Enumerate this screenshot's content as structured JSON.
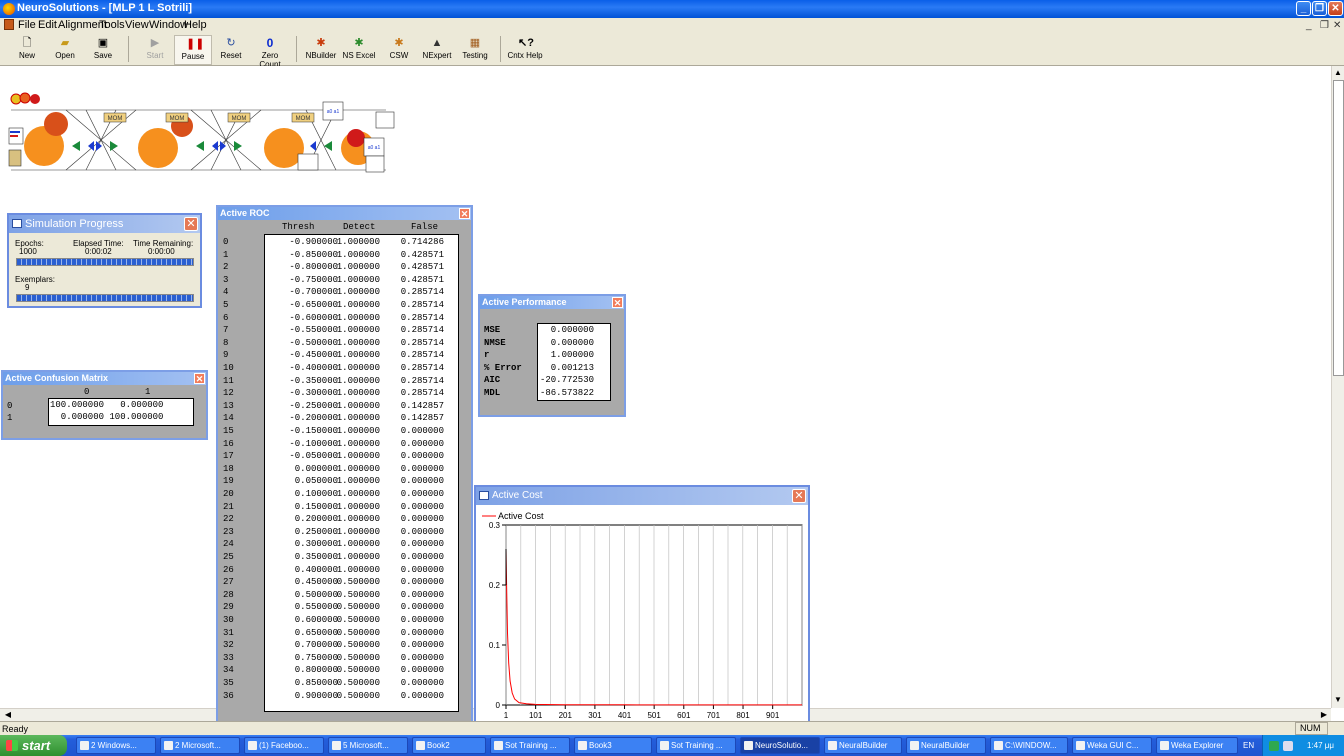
{
  "window": {
    "title": "NeuroSolutions - [MLP 1 L Sotrili]"
  },
  "menu": [
    "File",
    "Edit",
    "Alignment",
    "Tools",
    "View",
    "Window",
    "Help"
  ],
  "toolbar": {
    "new": "New",
    "open": "Open",
    "save": "Save",
    "start": "Start",
    "pause": "Pause",
    "reset": "Reset",
    "zero_count": "Zero Count",
    "zero_value": "0",
    "nbuilder": "NBuilder",
    "nsexcel": "NS Excel",
    "csw": "CSW",
    "nexpert": "NExpert",
    "testing": "Testing",
    "cntx_help": "Cntx Help"
  },
  "breadboard": {
    "mom_label": "MOM",
    "matrix_label": "a0 a1"
  },
  "sim_progress": {
    "title": "Simulation Progress",
    "epochs_label": "Epochs:",
    "epochs_value": "1000",
    "elapsed_label": "Elapsed Time:",
    "elapsed_value": "0:00:02",
    "remaining_label": "Time Remaining:",
    "remaining_value": "0:00:00",
    "exemplars_label": "Exemplars:",
    "exemplars_value": "9",
    "epoch_progress": 1.0,
    "exemplar_progress": 1.0
  },
  "confusion": {
    "title": "Active Confusion Matrix",
    "col_headers": [
      "0",
      "1"
    ],
    "rows": [
      {
        "label": "0",
        "values": "100.000000   0.000000"
      },
      {
        "label": "1",
        "values": "  0.000000 100.000000"
      }
    ]
  },
  "roc": {
    "title": "Active ROC",
    "headers": [
      "Thresh",
      "Detect",
      "False"
    ],
    "rows": [
      [
        "0",
        "-0.900000",
        "1.000000",
        "0.714286"
      ],
      [
        "1",
        "-0.850000",
        "1.000000",
        "0.428571"
      ],
      [
        "2",
        "-0.800000",
        "1.000000",
        "0.428571"
      ],
      [
        "3",
        "-0.750000",
        "1.000000",
        "0.428571"
      ],
      [
        "4",
        "-0.700000",
        "1.000000",
        "0.285714"
      ],
      [
        "5",
        "-0.650000",
        "1.000000",
        "0.285714"
      ],
      [
        "6",
        "-0.600000",
        "1.000000",
        "0.285714"
      ],
      [
        "7",
        "-0.550000",
        "1.000000",
        "0.285714"
      ],
      [
        "8",
        "-0.500000",
        "1.000000",
        "0.285714"
      ],
      [
        "9",
        "-0.450000",
        "1.000000",
        "0.285714"
      ],
      [
        "10",
        "-0.400000",
        "1.000000",
        "0.285714"
      ],
      [
        "11",
        "-0.350000",
        "1.000000",
        "0.285714"
      ],
      [
        "12",
        "-0.300000",
        "1.000000",
        "0.285714"
      ],
      [
        "13",
        "-0.250000",
        "1.000000",
        "0.142857"
      ],
      [
        "14",
        "-0.200000",
        "1.000000",
        "0.142857"
      ],
      [
        "15",
        "-0.150000",
        "1.000000",
        "0.000000"
      ],
      [
        "16",
        "-0.100000",
        "1.000000",
        "0.000000"
      ],
      [
        "17",
        "-0.050000",
        "1.000000",
        "0.000000"
      ],
      [
        "18",
        "0.000000",
        "1.000000",
        "0.000000"
      ],
      [
        "19",
        "0.050000",
        "1.000000",
        "0.000000"
      ],
      [
        "20",
        "0.100000",
        "1.000000",
        "0.000000"
      ],
      [
        "21",
        "0.150000",
        "1.000000",
        "0.000000"
      ],
      [
        "22",
        "0.200000",
        "1.000000",
        "0.000000"
      ],
      [
        "23",
        "0.250000",
        "1.000000",
        "0.000000"
      ],
      [
        "24",
        "0.300000",
        "1.000000",
        "0.000000"
      ],
      [
        "25",
        "0.350000",
        "1.000000",
        "0.000000"
      ],
      [
        "26",
        "0.400000",
        "1.000000",
        "0.000000"
      ],
      [
        "27",
        "0.450000",
        "0.500000",
        "0.000000"
      ],
      [
        "28",
        "0.500000",
        "0.500000",
        "0.000000"
      ],
      [
        "29",
        "0.550000",
        "0.500000",
        "0.000000"
      ],
      [
        "30",
        "0.600000",
        "0.500000",
        "0.000000"
      ],
      [
        "31",
        "0.650000",
        "0.500000",
        "0.000000"
      ],
      [
        "32",
        "0.700000",
        "0.500000",
        "0.000000"
      ],
      [
        "33",
        "0.750000",
        "0.500000",
        "0.000000"
      ],
      [
        "34",
        "0.800000",
        "0.500000",
        "0.000000"
      ],
      [
        "35",
        "0.850000",
        "0.500000",
        "0.000000"
      ],
      [
        "36",
        "0.900000",
        "0.500000",
        "0.000000"
      ]
    ]
  },
  "performance": {
    "title": "Active Performance",
    "rows": [
      {
        "label": "MSE",
        "value": "0.000000"
      },
      {
        "label": "NMSE",
        "value": "0.000000"
      },
      {
        "label": "r",
        "value": "1.000000"
      },
      {
        "label": "% Error",
        "value": "0.001213"
      },
      {
        "label": "AIC",
        "value": "-20.772530"
      },
      {
        "label": "MDL",
        "value": "-86.573822"
      }
    ]
  },
  "cost": {
    "title": "Active Cost",
    "legend": "Active Cost"
  },
  "chart_data": {
    "type": "line",
    "title": "",
    "xlabel": "",
    "ylabel": "",
    "legend": [
      "Active Cost"
    ],
    "legend_position": "top-left",
    "xlim": [
      1,
      1000
    ],
    "ylim": [
      0,
      0.3
    ],
    "x_ticks": [
      "1",
      "101",
      "201",
      "301",
      "401",
      "501",
      "601",
      "701",
      "801",
      "901"
    ],
    "y_ticks": [
      "0",
      "0.1",
      "0.2",
      "0.3"
    ],
    "grid": "vertical",
    "series": [
      {
        "name": "Active Cost",
        "color": "#ff0000",
        "x": [
          1,
          3,
          6,
          10,
          15,
          22,
          30,
          45,
          70,
          100,
          200,
          400,
          600,
          800,
          1000
        ],
        "y": [
          0.26,
          0.2,
          0.12,
          0.07,
          0.04,
          0.02,
          0.01,
          0.004,
          0.002,
          0.001,
          0.0005,
          0.0003,
          0.0002,
          0.0001,
          0.0001
        ]
      }
    ]
  },
  "status": {
    "ready": "Ready",
    "num": "NUM"
  },
  "taskbar": {
    "start": "start",
    "tasks": [
      "2 Windows...",
      "2 Microsoft...",
      "(1) Faceboo...",
      "5 Microsoft...",
      "Book2",
      "Sot Training ...",
      "Book3",
      "Sot Training ...",
      "NeuroSolutio...",
      "NeuralBuilder",
      "NeuralBuilder",
      "C:\\WINDOW...",
      "Weka GUI C...",
      "Weka Explorer"
    ],
    "active_task": "NeuroSolutio...",
    "lang": "EN",
    "clock": "1:47 μμ"
  },
  "colors": {
    "title_blue": "#0a5fe8",
    "cost_line": "#ff0000",
    "probe_gray": "#a9a9a9"
  }
}
